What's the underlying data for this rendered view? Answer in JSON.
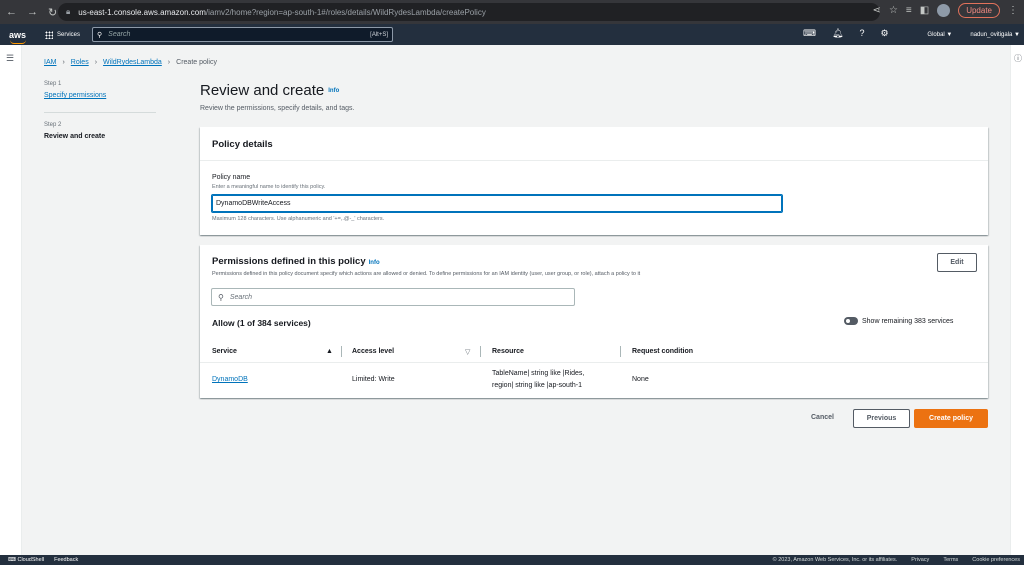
{
  "browser": {
    "url_host": "us-east-1.console.aws.amazon.com",
    "url_path": "/iamv2/home?region=ap-south-1#/roles/details/WildRydesLambda/createPolicy",
    "update_label": "Update"
  },
  "aws_nav": {
    "logo": "aws",
    "services_label": "Services",
    "search_placeholder": "Search",
    "search_shortcut": "[Alt+S]",
    "region": "Global ▼",
    "user": "nadun_ovitigala ▼"
  },
  "breadcrumb": {
    "items": [
      "IAM",
      "Roles",
      "WildRydesLambda"
    ],
    "current": "Create policy"
  },
  "steps": [
    {
      "num": "Step 1",
      "label": "Specify permissions"
    },
    {
      "num": "Step 2",
      "label": "Review and create"
    }
  ],
  "page": {
    "title": "Review and create",
    "info": "Info",
    "subtitle": "Review the permissions, specify details, and tags."
  },
  "policy_details": {
    "header": "Policy details",
    "name_label": "Policy name",
    "name_description": "Enter a meaningful name to identify this policy.",
    "name_value": "DynamoDBWriteAccess",
    "constraint": "Maximum 128 characters. Use alphanumeric and '+=,.@-_' characters."
  },
  "permissions": {
    "header": "Permissions defined in this policy",
    "info": "Info",
    "description": "Permissions defined in this policy document specify which actions are allowed or denied. To define permissions for an IAM identity (user, user group, or role), attach a policy to it",
    "edit_label": "Edit",
    "search_placeholder": "Search",
    "allow_label": "Allow (1 of 384 services)",
    "toggle_label": "Show remaining 383 services",
    "columns": [
      "Service",
      "Access level",
      "Resource",
      "Request condition"
    ],
    "rows": [
      {
        "service": "DynamoDB",
        "access_level": "Limited: Write",
        "resource_line1": "TableName| string like |Rides,",
        "resource_line2": "region| string like |ap-south-1",
        "request_condition": "None"
      }
    ]
  },
  "actions": {
    "cancel": "Cancel",
    "previous": "Previous",
    "create": "Create policy"
  },
  "footer": {
    "cloudshell": "CloudShell",
    "feedback": "Feedback",
    "copyright": "© 2023, Amazon Web Services, Inc. or its affiliates.",
    "privacy": "Privacy",
    "terms": "Terms",
    "cookies": "Cookie preferences"
  }
}
